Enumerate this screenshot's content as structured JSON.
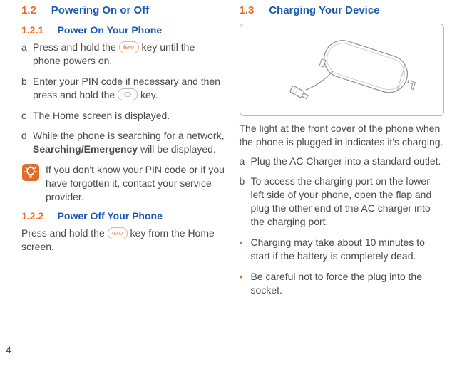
{
  "page_number": "4",
  "left": {
    "h1_num": "1.2",
    "h1_title": "Powering On or Off",
    "s1": {
      "num": "1.2.1",
      "title": "Power On Your Phone",
      "steps": [
        {
          "marker": "a",
          "pre": "Press and hold the ",
          "post": " key until the phone powers on.",
          "key": "end"
        },
        {
          "marker": "b",
          "pre": "Enter your PIN code if necessary and then press and hold the ",
          "post": " key.",
          "key": "ok"
        },
        {
          "marker": "c",
          "text": "The Home screen is displayed."
        },
        {
          "marker": "d",
          "pre": "While the phone is searching for a network, ",
          "bold": "Searching/Emergency",
          "post": " will be displayed."
        }
      ],
      "tip": "If you don't know your PIN code or if you have forgotten it, contact your service provider."
    },
    "s2": {
      "num": "1.2.2",
      "title": "Power Off Your Phone",
      "body_pre": "Press and hold the ",
      "body_post": " key from the Home screen."
    }
  },
  "right": {
    "h1_num": "1.3",
    "h1_title": "Charging Your Device",
    "intro": "The light at the front cover of the phone when the phone is plugged in indicates it's charging.",
    "steps": [
      {
        "marker": "a",
        "text": "Plug the AC Charger into a standard outlet."
      },
      {
        "marker": "b",
        "text": "To access the charging port on the lower left side of your phone, open the flap and plug the other end of the AC charger into the charging port."
      }
    ],
    "bullets": [
      "Charging may take about 10 minutes to start if the battery is completely dead.",
      "Be careful not to force the plug into the socket."
    ]
  }
}
